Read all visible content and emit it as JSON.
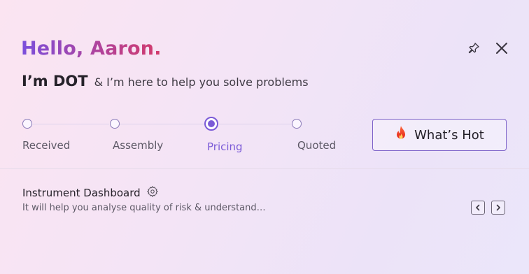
{
  "header": {
    "greeting": "Hello, Aaron.",
    "brand": "I’m DOT",
    "tagline": "& I’m here to help you solve problems",
    "pin_icon": "pin-icon",
    "close_icon": "close-icon"
  },
  "stepper": {
    "steps": [
      {
        "label": "Received",
        "state": "inactive"
      },
      {
        "label": "Assembly",
        "state": "inactive"
      },
      {
        "label": "Pricing",
        "state": "active"
      },
      {
        "label": "Quoted",
        "state": "inactive"
      }
    ],
    "active_color": "#7b5bd7"
  },
  "hot_button": {
    "label": "What’s Hot",
    "icon": "flame-icon"
  },
  "dashboard": {
    "title": "Instrument Dashboard",
    "settings_icon": "gear-icon",
    "description": "It will help you analyse quality of risk & understand…",
    "prev_icon": "chevron-left-icon",
    "next_icon": "chevron-right-icon"
  },
  "colors": {
    "accent": "#7b5bd7",
    "greeting_gradient": [
      "#7a4fdc",
      "#d33a6a"
    ]
  }
}
